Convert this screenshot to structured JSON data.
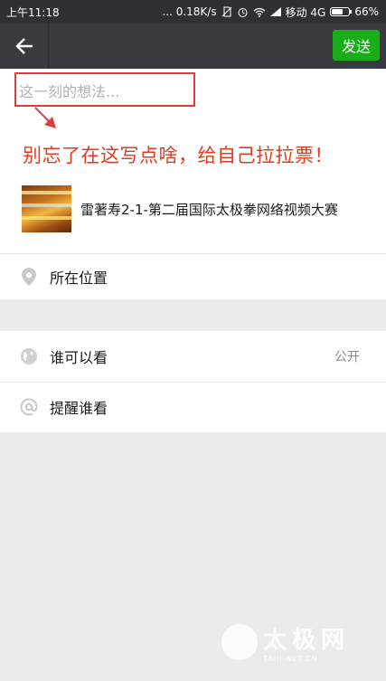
{
  "status_bar": {
    "time": "上午11:18",
    "network_speed": "... 0.18K/s",
    "carrier": "移动 4G",
    "battery_percent": "66%",
    "battery_level": 0.66,
    "icons": [
      "no-sim-icon",
      "alarm-icon",
      "wifi-icon",
      "signal-icon",
      "battery-icon"
    ]
  },
  "header": {
    "back_icon": "back-arrow-icon",
    "send_label": "发送",
    "send_color": "#19ad19"
  },
  "composer": {
    "placeholder": "这一刻的想法...",
    "annotation": "别忘了在这写点啥，给自己拉拉票！",
    "annotation_color": "#e43a1f"
  },
  "shared_link": {
    "title": "雷著寿2-1-第二届国际太极拳网络视频大赛"
  },
  "location": {
    "label": "所在位置",
    "icon": "location-pin-icon"
  },
  "visibility": {
    "label": "谁可以看",
    "value": "公开",
    "icon": "globe-icon"
  },
  "mention": {
    "label": "提醒谁看",
    "icon": "at-icon"
  },
  "watermark": {
    "main": "太极网",
    "sub": "TAIJI-NET.CN"
  }
}
